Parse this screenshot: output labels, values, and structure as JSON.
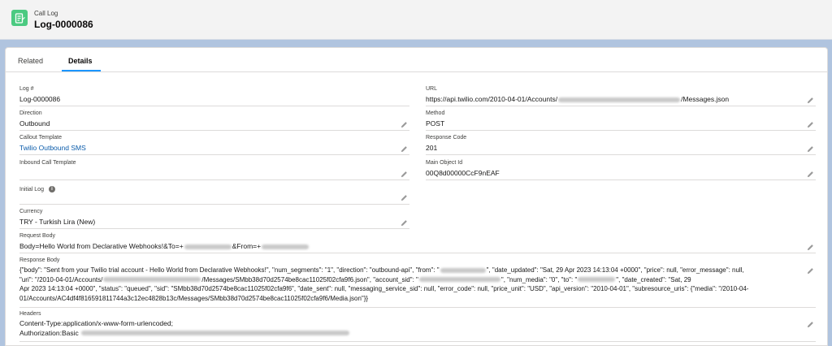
{
  "header": {
    "object_label": "Call Log",
    "record_title": "Log-0000086",
    "icon": "call-log-icon",
    "icon_color": "#4bca81"
  },
  "tabs": [
    {
      "label": "Related",
      "active": false
    },
    {
      "label": "Details",
      "active": true
    }
  ],
  "accent_color": "#1b96ff",
  "link_color": "#0b5cab",
  "fields": {
    "log_number": {
      "label": "Log #",
      "value": "Log-0000086"
    },
    "url": {
      "label": "URL",
      "value_prefix": "https://api.twilio.com/2010-04-01/Accounts/",
      "value_suffix": "/Messages.json"
    },
    "direction": {
      "label": "Direction",
      "value": "Outbound"
    },
    "method": {
      "label": "Method",
      "value": "POST"
    },
    "callout_template": {
      "label": "Callout Template",
      "value": "Twilio Outbound SMS"
    },
    "response_code": {
      "label": "Response Code",
      "value": "201"
    },
    "inbound_call_template": {
      "label": "Inbound Call Template",
      "value": ""
    },
    "main_object_id": {
      "label": "Main Object Id",
      "value": "00Q8d00000CcF9nEAF"
    },
    "initial_log": {
      "label": "Initial Log",
      "value": ""
    },
    "currency": {
      "label": "Currency",
      "value": "TRY - Turkish Lira (New)"
    },
    "request_body": {
      "label": "Request Body",
      "value_prefix": "Body=Hello World from Declarative Webhooks!&To=+",
      "value_middle": "&From=+"
    },
    "response_body": {
      "label": "Response Body",
      "line1_a": "{\"body\": \"Sent from your Twilio trial account - Hello World from Declarative Webhooks!\", \"num_segments\": \"1\", \"direction\": \"outbound-api\", \"from\": \"",
      "line1_b": "\", \"date_updated\": \"Sat, 29 Apr 2023 14:13:04 +0000\", \"price\": null, \"error_message\": null,",
      "line2_a": "\"uri\": \"/2010-04-01/Accounts/",
      "line2_b": "/Messages/SMbb38d70d2574be8cac11025f02cfa9f6.json\", \"account_sid\": \"",
      "line2_c": "\", \"num_media\": \"0\", \"to\": \"",
      "line2_d": "\", \"date_created\": \"Sat, 29",
      "line3": "Apr 2023 14:13:04 +0000\", \"status\": \"queued\", \"sid\": \"SMbb38d70d2574be8cac11025f02cfa9f6\", \"date_sent\": null, \"messaging_service_sid\": null, \"error_code\": null, \"price_unit\": \"USD\", \"api_version\": \"2010-04-01\", \"subresource_uris\": {\"media\": \"/2010-04-",
      "line4": "01/Accounts/AC4df4f816591811744a3c12ec4828b13c/Messages/SMbb38d70d2574be8cac11025f02cfa9f6/Media.json\"}}"
    },
    "headers": {
      "label": "Headers",
      "line1": "Content-Type:application/x-www-form-urlencoded;",
      "line2_prefix": "Authorization:Basic "
    }
  }
}
